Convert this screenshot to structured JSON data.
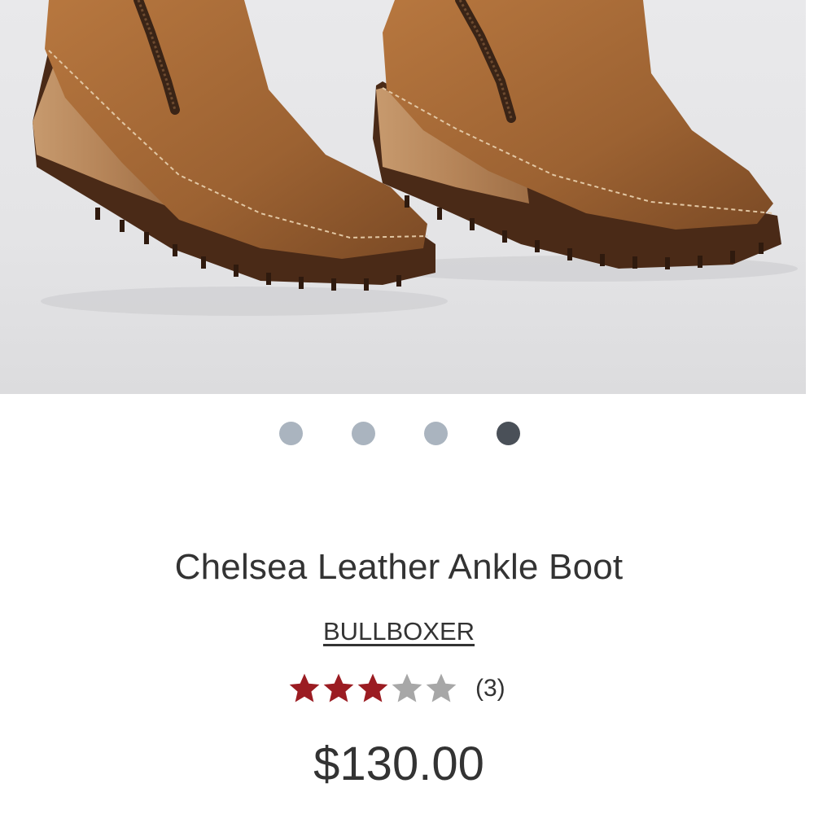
{
  "product": {
    "image_alt": "brown leather wedge ankle boots with side zippers",
    "gallery": {
      "total": 4,
      "active_index": 3
    },
    "title": "Chelsea Leather Ankle Boot",
    "brand": "BULLBOXER",
    "rating": {
      "value": 3,
      "max": 5,
      "count_label": "(3)"
    },
    "price": "$130.00"
  },
  "colors": {
    "star_filled": "#9b1c22",
    "star_empty": "#a7a7a7",
    "dot_inactive": "#aab4bf",
    "dot_active": "#4a5058",
    "text": "#333333"
  }
}
